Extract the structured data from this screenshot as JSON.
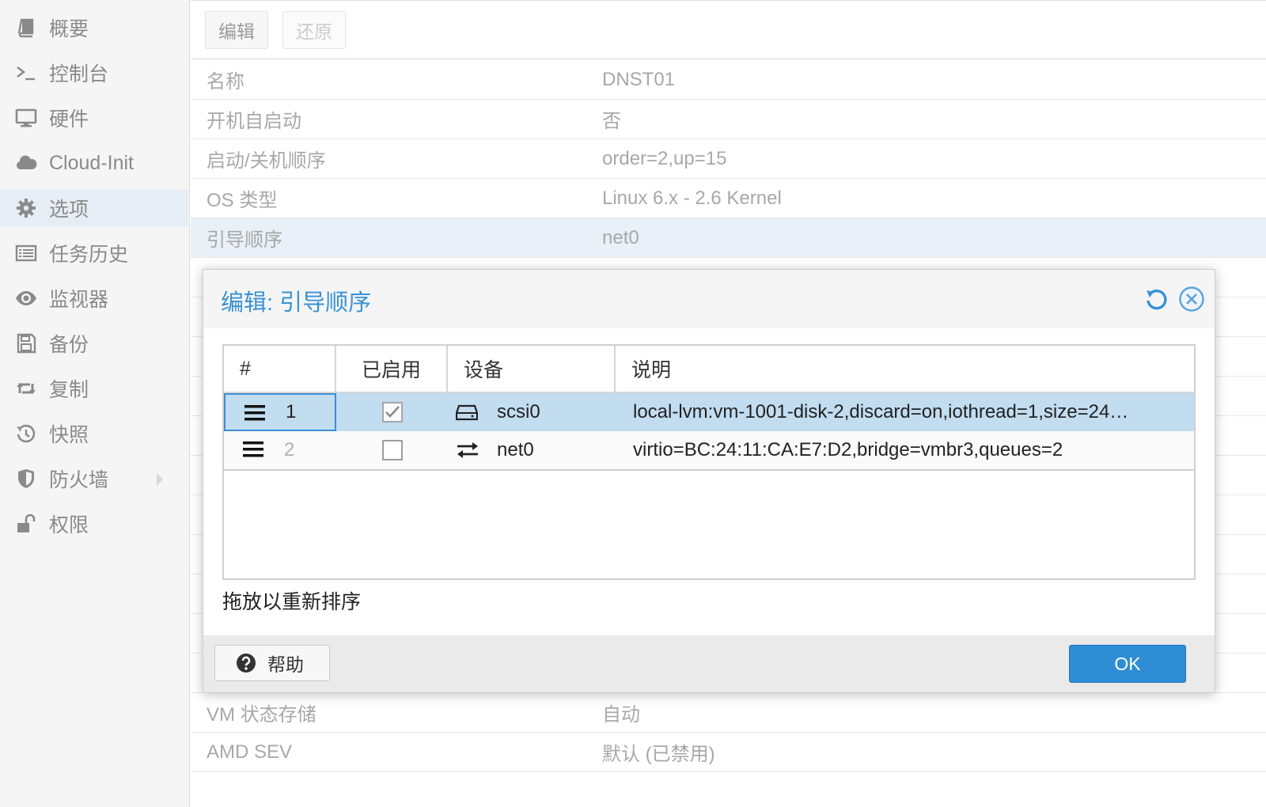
{
  "sidebar": {
    "items": [
      {
        "label": "概要",
        "icon": "book-icon"
      },
      {
        "label": "控制台",
        "icon": "terminal-icon"
      },
      {
        "label": "硬件",
        "icon": "monitor-icon"
      },
      {
        "label": "Cloud-Init",
        "icon": "cloud-icon"
      },
      {
        "label": "选项",
        "icon": "gear-icon",
        "selected": true
      },
      {
        "label": "任务历史",
        "icon": "list-icon"
      },
      {
        "label": "监视器",
        "icon": "eye-icon"
      },
      {
        "label": "备份",
        "icon": "floppy-icon"
      },
      {
        "label": "复制",
        "icon": "retweet-icon"
      },
      {
        "label": "快照",
        "icon": "history-icon"
      },
      {
        "label": "防火墙",
        "icon": "shield-icon",
        "has_submenu": true
      },
      {
        "label": "权限",
        "icon": "unlock-icon"
      }
    ]
  },
  "toolbar": {
    "edit_label": "编辑",
    "revert_label": "还原"
  },
  "options": {
    "rows": [
      {
        "key": "名称",
        "value": "DNST01"
      },
      {
        "key": "开机自启动",
        "value": "否"
      },
      {
        "key": "启动/关机顺序",
        "value": "order=2,up=15"
      },
      {
        "key": "OS 类型",
        "value": "Linux 6.x - 2.6 Kernel"
      },
      {
        "key": "引导顺序",
        "value": "net0",
        "selected": true
      }
    ],
    "bottom_rows": [
      {
        "key": "VM 状态存储",
        "value": "自动"
      },
      {
        "key": "AMD SEV",
        "value": "默认 (已禁用)"
      }
    ]
  },
  "dialog": {
    "title": "编辑: 引导顺序",
    "columns": {
      "order": "#",
      "enabled": "已启用",
      "device": "设备",
      "description": "说明"
    },
    "rows": [
      {
        "order": "1",
        "enabled": true,
        "device": "scsi0",
        "device_icon": "harddisk-icon",
        "description": "local-lvm:vm-1001-disk-2,discard=on,iothread=1,size=24…"
      },
      {
        "order": "2",
        "enabled": false,
        "device": "net0",
        "device_icon": "network-exchange-icon",
        "description": "virtio=BC:24:11:CA:E7:D2,bridge=vmbr3,queues=2"
      }
    ],
    "hint": "拖放以重新排序",
    "help_label": "帮助",
    "ok_label": "OK"
  },
  "colors": {
    "accent": "#3892d4",
    "ok_button": "#2f8dd6",
    "selected_row": "#c2dcf0"
  }
}
